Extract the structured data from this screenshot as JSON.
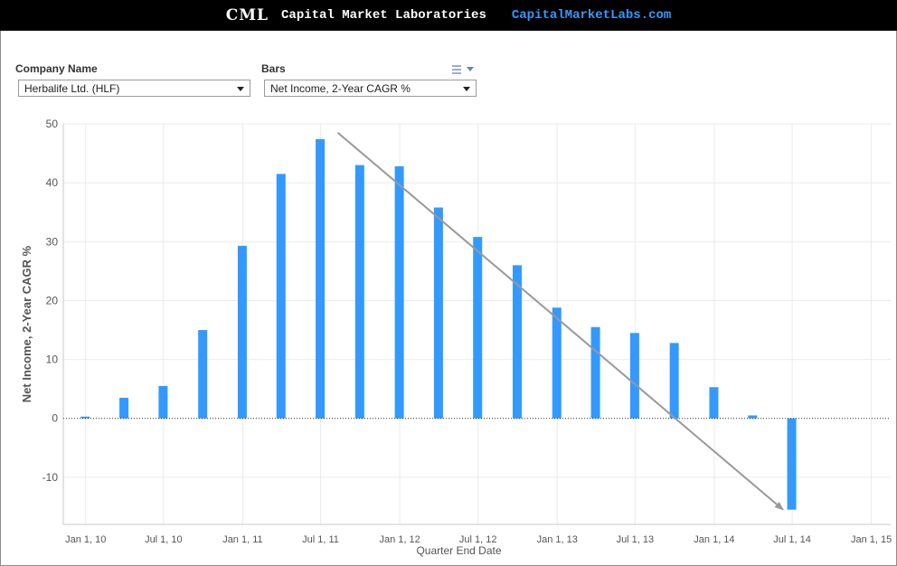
{
  "banner": {
    "logo": "CML",
    "name": "Capital Market Laboratories",
    "link": "CapitalMarketLabs.com"
  },
  "filters": {
    "company_label": "Company Name",
    "company_value": "Herbalife Ltd. (HLF)",
    "bars_label": "Bars",
    "bars_value": "Net Income, 2-Year CAGR %"
  },
  "colors": {
    "bar": "#3399ff",
    "trend_arrow": "#999999",
    "grid": "#ebebeb",
    "axis_text": "#555555"
  },
  "chart_data": {
    "type": "bar",
    "xlabel": "Quarter End Date",
    "ylabel": "Net Income, 2-Year CAGR %",
    "ylim": [
      -18,
      50
    ],
    "yticks": [
      50,
      40,
      30,
      20,
      10,
      0,
      -10
    ],
    "xlim": [
      "2009-11-10",
      "2015-02-15"
    ],
    "xticks": [
      {
        "date": "2010-01-01",
        "label": "Jan 1, 10"
      },
      {
        "date": "2010-07-01",
        "label": "Jul 1, 10"
      },
      {
        "date": "2011-01-01",
        "label": "Jan 1, 11"
      },
      {
        "date": "2011-07-01",
        "label": "Jul 1, 11"
      },
      {
        "date": "2012-01-01",
        "label": "Jan 1, 12"
      },
      {
        "date": "2012-07-01",
        "label": "Jul 1, 12"
      },
      {
        "date": "2013-01-01",
        "label": "Jan 1, 13"
      },
      {
        "date": "2013-07-01",
        "label": "Jul 1, 13"
      },
      {
        "date": "2014-01-01",
        "label": "Jan 1, 14"
      },
      {
        "date": "2014-07-01",
        "label": "Jul 1, 14"
      },
      {
        "date": "2015-01-01",
        "label": "Jan 1, 15"
      }
    ],
    "grid": true,
    "zero_line": "dotted",
    "series": [
      {
        "points": [
          {
            "date": "2009-12-31",
            "value": 0.3
          },
          {
            "date": "2010-03-31",
            "value": 3.5
          },
          {
            "date": "2010-06-30",
            "value": 5.5
          },
          {
            "date": "2010-09-30",
            "value": 15.0
          },
          {
            "date": "2010-12-31",
            "value": 29.3
          },
          {
            "date": "2011-03-31",
            "value": 41.5
          },
          {
            "date": "2011-06-30",
            "value": 47.4
          },
          {
            "date": "2011-09-30",
            "value": 43.0
          },
          {
            "date": "2011-12-31",
            "value": 42.8
          },
          {
            "date": "2012-03-31",
            "value": 35.8
          },
          {
            "date": "2012-06-30",
            "value": 30.8
          },
          {
            "date": "2012-09-30",
            "value": 26.0
          },
          {
            "date": "2012-12-31",
            "value": 18.8
          },
          {
            "date": "2013-03-31",
            "value": 15.5
          },
          {
            "date": "2013-06-30",
            "value": 14.5
          },
          {
            "date": "2013-09-30",
            "value": 12.8
          },
          {
            "date": "2013-12-31",
            "value": 5.3
          },
          {
            "date": "2014-03-31",
            "value": 0.5
          },
          {
            "date": "2014-06-30",
            "value": -15.5
          }
        ]
      }
    ],
    "annotations": [
      {
        "type": "trend-arrow",
        "from": {
          "date": "2011-08-10",
          "value": 48.5
        },
        "to": {
          "date": "2014-06-10",
          "value": -15.5
        }
      }
    ]
  }
}
